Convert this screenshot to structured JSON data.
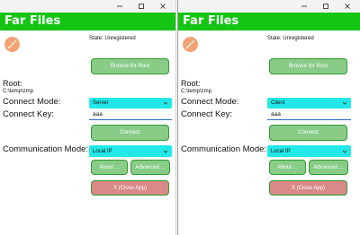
{
  "app_title": "Far Files",
  "colors": {
    "header": "#14c514",
    "button": "#88cc88",
    "close_button": "#d98a86",
    "select": "#22e8e8"
  },
  "windows": [
    {
      "state": "State: Unregistered",
      "browse_label": "Browse for Root",
      "root_label": "Root:",
      "root_path": "C:\\temp\\zmp",
      "connect_mode_label": "Connect Mode:",
      "connect_mode_value": "Server",
      "connect_key_label": "Connect Key:",
      "connect_key_value": "aaa",
      "connect_label": "Connect",
      "comm_mode_label": "Communication Mode:",
      "comm_mode_value": "Local IP",
      "about_label": "About ...",
      "advanced_label": "Advanced ...",
      "close_label": "X (Close App)"
    },
    {
      "state": "State: Unregistered",
      "browse_label": "Browse for Root",
      "root_label": "Root:",
      "root_path": "C:\\temp\\zmp",
      "connect_mode_label": "Connect Mode:",
      "connect_mode_value": "Client",
      "connect_key_label": "Connect Key:",
      "connect_key_value": "aaa",
      "connect_label": "Connect",
      "comm_mode_label": "Communication Mode:",
      "comm_mode_value": "Local IP",
      "about_label": "About ...",
      "advanced_label": "Advanced ...",
      "close_label": "X (Close App)"
    }
  ]
}
